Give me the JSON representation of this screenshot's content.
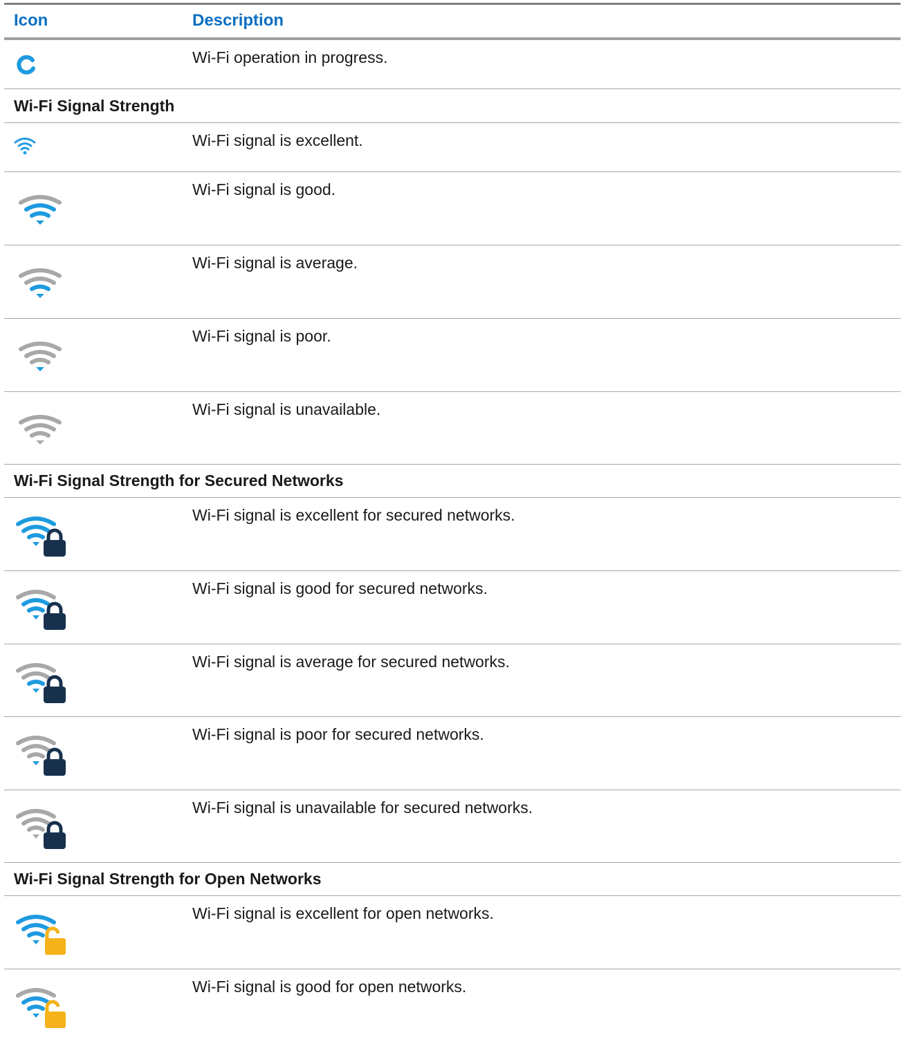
{
  "header": {
    "icon_label": "Icon",
    "description_label": "Description"
  },
  "colors": {
    "accent": "#0b6fc2",
    "wifi_blue": "#1e9be0",
    "wifi_grey": "#a8a8a8",
    "lock_dark": "#17314d",
    "lock_open": "#f5b21a"
  },
  "rows": [
    {
      "icon": "wifi-progress-icon",
      "description": "Wi-Fi operation in progress."
    },
    {
      "section": "Wi-Fi Signal Strength"
    },
    {
      "icon": "wifi-excellent-icon",
      "description": "Wi-Fi signal is excellent."
    },
    {
      "icon": "wifi-good-icon",
      "description": "Wi-Fi signal is good."
    },
    {
      "icon": "wifi-average-icon",
      "description": "Wi-Fi signal is average."
    },
    {
      "icon": "wifi-poor-icon",
      "description": "Wi-Fi signal is poor."
    },
    {
      "icon": "wifi-unavailable-icon",
      "description": "Wi-Fi signal is unavailable."
    },
    {
      "section": "Wi-Fi Signal Strength for Secured Networks"
    },
    {
      "icon": "wifi-secured-excellent-icon",
      "description": "Wi-Fi signal is excellent for secured networks."
    },
    {
      "icon": "wifi-secured-good-icon",
      "description": "Wi-Fi signal is good for secured networks."
    },
    {
      "icon": "wifi-secured-average-icon",
      "description": "Wi-Fi signal is average for secured networks."
    },
    {
      "icon": "wifi-secured-poor-icon",
      "description": "Wi-Fi signal is poor for secured networks."
    },
    {
      "icon": "wifi-secured-unavailable-icon",
      "description": "Wi-Fi signal is unavailable for secured networks."
    },
    {
      "section": "Wi-Fi Signal Strength for Open Networks"
    },
    {
      "icon": "wifi-open-excellent-icon",
      "description": "Wi-Fi signal is excellent for open networks."
    },
    {
      "icon": "wifi-open-good-icon",
      "description": "Wi-Fi signal is good for open networks."
    }
  ]
}
